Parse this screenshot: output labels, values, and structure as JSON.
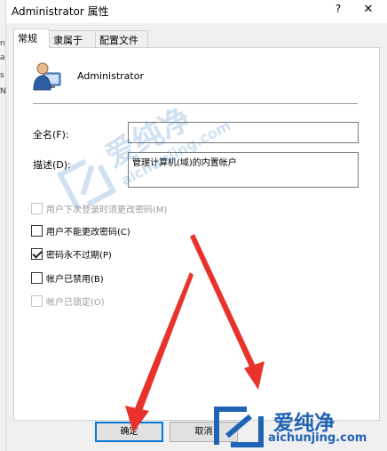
{
  "window": {
    "title": "Administrator 属性",
    "help_glyph": "?",
    "close_glyph": "✕"
  },
  "tabs": [
    {
      "label": "常规",
      "active": true
    },
    {
      "label": "隶属于",
      "active": false
    },
    {
      "label": "配置文件",
      "active": false
    }
  ],
  "general": {
    "username": "Administrator",
    "full_name_label": "全名(F):",
    "full_name_value": "",
    "description_label": "描述(D):",
    "description_value": "管理计算机(域)的内置帐户"
  },
  "checkboxes": [
    {
      "label": "用户下次登录时须更改密码(M)",
      "checked": false,
      "disabled": true
    },
    {
      "label": "用户不能更改密码(C)",
      "checked": false,
      "disabled": false
    },
    {
      "label": "密码永不过期(P)",
      "checked": true,
      "disabled": false
    },
    {
      "label": "帐户已禁用(B)",
      "checked": false,
      "disabled": false
    },
    {
      "label": "帐户已锁定(O)",
      "checked": false,
      "disabled": true
    }
  ],
  "buttons": {
    "ok": "确定",
    "cancel": "取消"
  },
  "background_window": {
    "fragments": [
      "ni",
      "ar",
      "s",
      "N-"
    ]
  },
  "watermark": {
    "cn": "爱纯净",
    "en": "aichunjing.com"
  },
  "logo": {
    "cn": "爱纯净",
    "en": "aichunjing.com"
  },
  "colors": {
    "annotation_arrow": "#e8322b",
    "brand_blue": "#1f63b5",
    "focus_blue": "#0078d7"
  }
}
